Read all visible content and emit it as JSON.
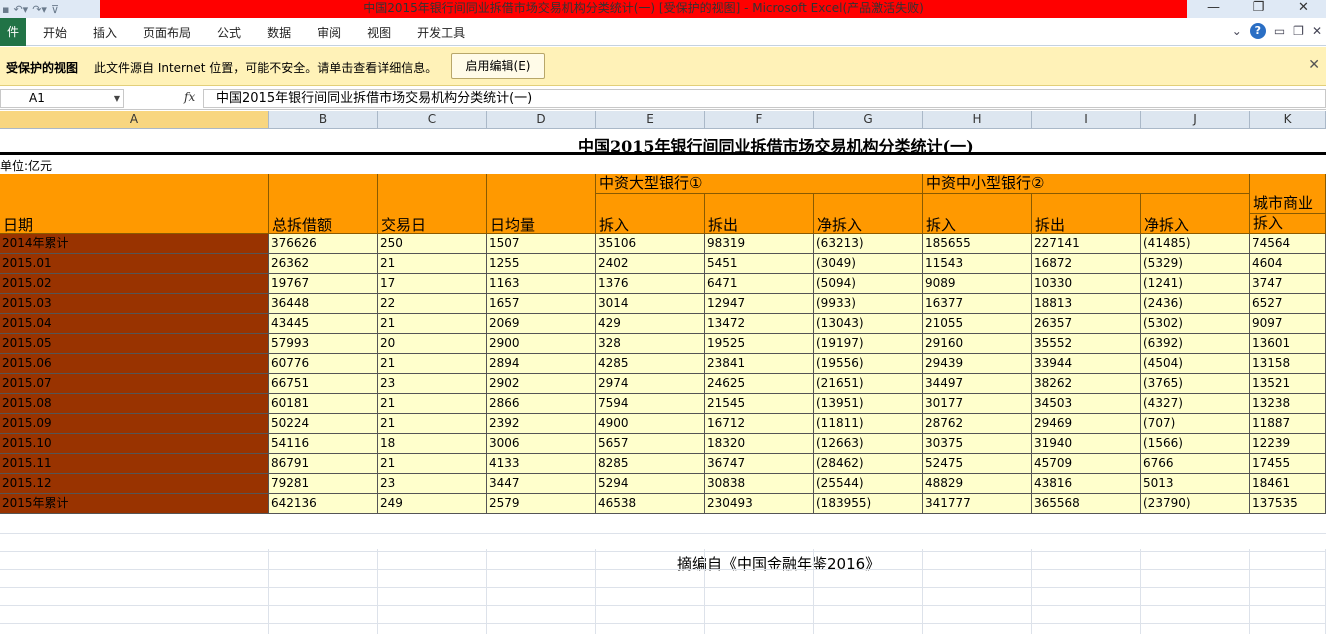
{
  "window": {
    "title": "中国2015年银行间同业拆借市场交易机构分类统计(一)  [受保护的视图]  -  Microsoft Excel(产品激活失败)",
    "controls": [
      "—",
      "❐",
      "✕"
    ]
  },
  "ribbon": {
    "file_tab": "件",
    "tabs": [
      "开始",
      "插入",
      "页面布局",
      "公式",
      "数据",
      "审阅",
      "视图",
      "开发工具"
    ]
  },
  "protected_view": {
    "title": "受保护的视图",
    "message": "此文件源自 Internet 位置，可能不安全。请单击查看详细信息。",
    "enable_button": "启用编辑(E)"
  },
  "formula_bar": {
    "name_box": "A1",
    "fx": "fx",
    "content": "中国2015年银行间同业拆借市场交易机构分类统计(一)"
  },
  "columns": [
    "A",
    "B",
    "C",
    "D",
    "E",
    "F",
    "G",
    "H",
    "I",
    "J",
    "K"
  ],
  "sheet": {
    "title": "中国2015年银行间同业拆借市场交易机构分类统计(一)",
    "unit": "单位:亿元",
    "headers": {
      "date": "日期",
      "total": "总拆借额",
      "days": "交易日",
      "avg": "日均量",
      "group1": "中资大型银行①",
      "group2": "中资中小型银行②",
      "group3": "城市商业",
      "in": "拆入",
      "out": "拆出",
      "net": "净拆入"
    },
    "rows": [
      [
        "2014年累计",
        "376626",
        "250",
        "1507",
        "35106",
        "98319",
        "(63213)",
        "185655",
        "227141",
        "(41485)",
        "74564"
      ],
      [
        "2015.01",
        "26362",
        "21",
        "1255",
        "2402",
        "5451",
        "(3049)",
        "11543",
        "16872",
        "(5329)",
        "4604"
      ],
      [
        "2015.02",
        "19767",
        "17",
        "1163",
        "1376",
        "6471",
        "(5094)",
        "9089",
        "10330",
        "(1241)",
        "3747"
      ],
      [
        "2015.03",
        "36448",
        "22",
        "1657",
        "3014",
        "12947",
        "(9933)",
        "16377",
        "18813",
        "(2436)",
        "6527"
      ],
      [
        "2015.04",
        "43445",
        "21",
        "2069",
        "429",
        "13472",
        "(13043)",
        "21055",
        "26357",
        "(5302)",
        "9097"
      ],
      [
        "2015.05",
        "57993",
        "20",
        "2900",
        "328",
        "19525",
        "(19197)",
        "29160",
        "35552",
        "(6392)",
        "13601"
      ],
      [
        "2015.06",
        "60776",
        "21",
        "2894",
        "4285",
        "23841",
        "(19556)",
        "29439",
        "33944",
        "(4504)",
        "13158"
      ],
      [
        "2015.07",
        "66751",
        "23",
        "2902",
        "2974",
        "24625",
        "(21651)",
        "34497",
        "38262",
        "(3765)",
        "13521"
      ],
      [
        "2015.08",
        "60181",
        "21",
        "2866",
        "7594",
        "21545",
        "(13951)",
        "30177",
        "34503",
        "(4327)",
        "13238"
      ],
      [
        "2015.09",
        "50224",
        "21",
        "2392",
        "4900",
        "16712",
        "(11811)",
        "28762",
        "29469",
        "(707)",
        "11887"
      ],
      [
        "2015.10",
        "54116",
        "18",
        "3006",
        "5657",
        "18320",
        "(12663)",
        "30375",
        "31940",
        "(1566)",
        "12239"
      ],
      [
        "2015.11",
        "86791",
        "21",
        "4133",
        "8285",
        "36747",
        "(28462)",
        "52475",
        "45709",
        "6766",
        "17455"
      ],
      [
        "2015.12",
        "79281",
        "23",
        "3447",
        "5294",
        "30838",
        "(25544)",
        "48829",
        "43816",
        "5013",
        "18461"
      ],
      [
        "2015年累计",
        "642136",
        "249",
        "2579",
        "46538",
        "230493",
        "(183955)",
        "341777",
        "365568",
        "(23790)",
        "137535"
      ]
    ],
    "source": "摘编自《中国金融年鉴2016》"
  }
}
